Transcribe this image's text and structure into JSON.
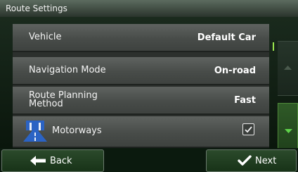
{
  "title_bar": {
    "title": "Route Settings"
  },
  "settings": {
    "items": [
      {
        "label": "Vehicle",
        "value": "Default Car"
      },
      {
        "label": "Navigation Mode",
        "value": "On-road"
      },
      {
        "label": "Route Planning Method",
        "value": "Fast"
      },
      {
        "label": "Motorways",
        "value": "",
        "checked": true,
        "icon": "motorway-icon"
      }
    ]
  },
  "scroll": {
    "up_icon": "triangle-up-icon",
    "down_icon": "triangle-down-icon"
  },
  "bottom_bar": {
    "back_label": "Back",
    "back_icon": "arrow-left-icon",
    "next_label": "Next",
    "next_icon": "checkmark-icon"
  },
  "colors": {
    "accent_green": "#9be84e",
    "highlight_arrow": "#5fd24a"
  }
}
